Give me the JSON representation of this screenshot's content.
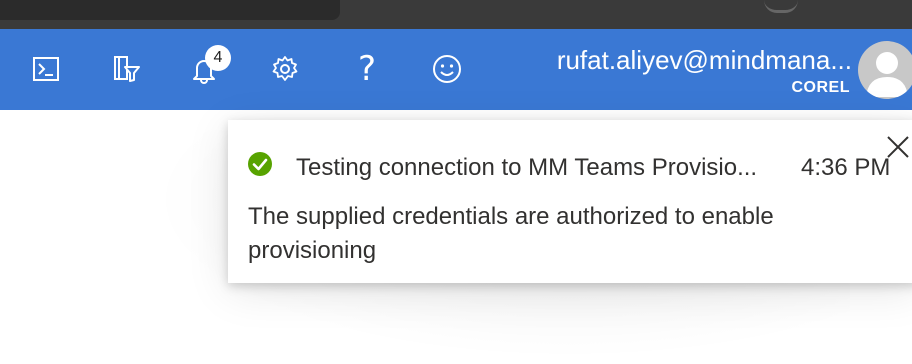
{
  "header": {
    "bg_color": "#3a78d4",
    "icons": [
      {
        "name": "cloud-shell-icon"
      },
      {
        "name": "directory-filter-icon"
      },
      {
        "name": "notifications-bell-icon"
      },
      {
        "name": "settings-gear-icon"
      },
      {
        "name": "help-icon"
      },
      {
        "name": "feedback-smiley-icon"
      }
    ],
    "notification_count": "4",
    "help_glyph": "?",
    "account": {
      "email": "rufat.aliyev@mindmana...",
      "tenant": "COREL"
    }
  },
  "toast": {
    "status_icon": "success-check-icon",
    "status_color": "#57a300",
    "title": "Testing connection to MM Teams Provisio...",
    "time": "4:36 PM",
    "message": "The supplied credentials are authorized to enable provisioning"
  }
}
